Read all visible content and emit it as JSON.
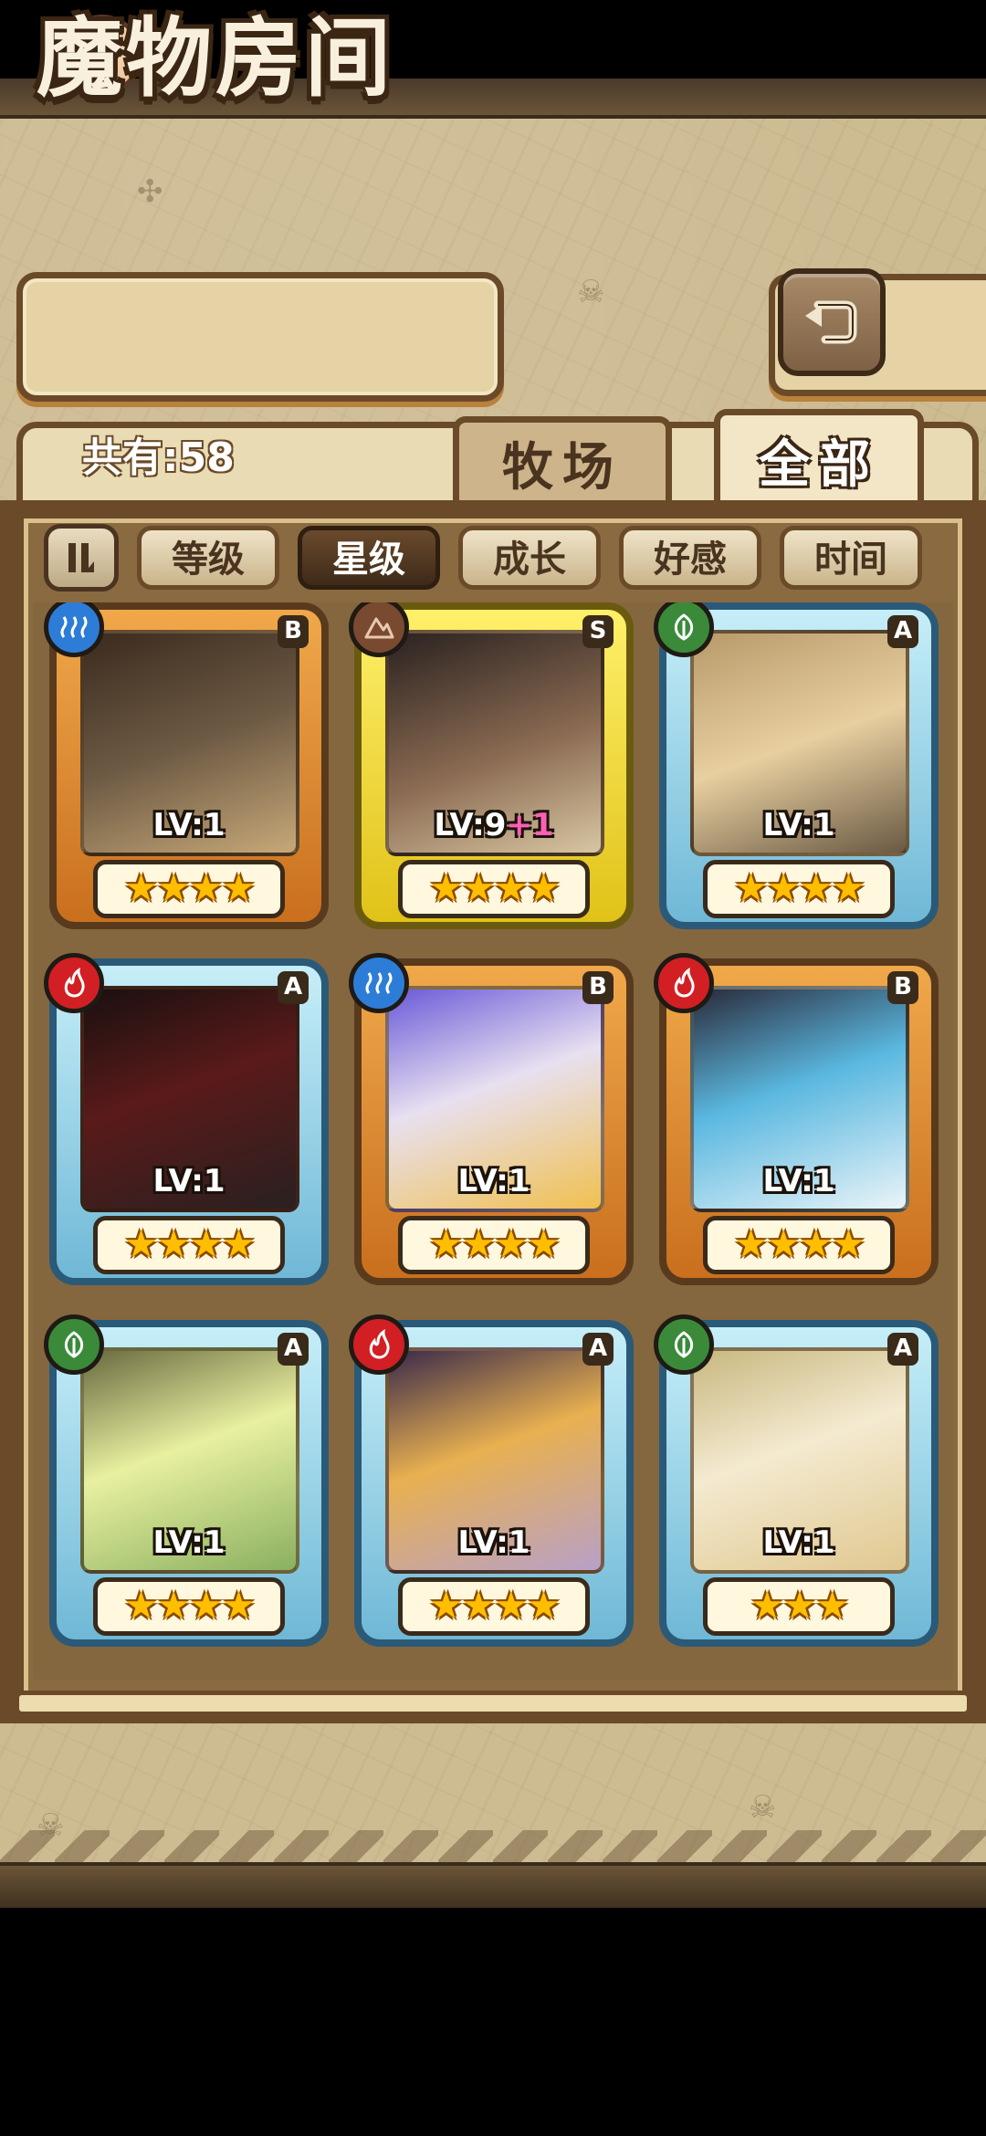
{
  "screen_title": "魔物房间",
  "count_label": "共有:58",
  "tabs": {
    "farm": "牧场",
    "all": "全部"
  },
  "filters": [
    "等级",
    "星级",
    "成长",
    "好感",
    "时间"
  ],
  "active_filter": "星级",
  "cards": [
    {
      "grade": "B",
      "element": "water",
      "level": "LV:1",
      "bonus": "",
      "stars": "★★★★"
    },
    {
      "grade": "S",
      "element": "earth",
      "level": "LV:9",
      "bonus": "+1",
      "stars": "★★★★"
    },
    {
      "grade": "A",
      "element": "grass",
      "level": "LV:1",
      "bonus": "",
      "stars": "★★★★"
    },
    {
      "grade": "A",
      "element": "fire",
      "level": "LV:1",
      "bonus": "",
      "stars": "★★★★"
    },
    {
      "grade": "B",
      "element": "water",
      "level": "LV:1",
      "bonus": "",
      "stars": "★★★★"
    },
    {
      "grade": "B",
      "element": "fire",
      "level": "LV:1",
      "bonus": "",
      "stars": "★★★★"
    },
    {
      "grade": "A",
      "element": "grass",
      "level": "LV:1",
      "bonus": "",
      "stars": "★★★★"
    },
    {
      "grade": "A",
      "element": "fire",
      "level": "LV:1",
      "bonus": "",
      "stars": "★★★★"
    },
    {
      "grade": "A",
      "element": "grass",
      "level": "LV:1",
      "bonus": "",
      "stars": "★★★"
    }
  ],
  "colors": {
    "rank_b": "#e08a2c",
    "rank_s": "#f3dc2e",
    "rank_a": "#8fcbe4",
    "water": "#2d7dd8",
    "fire": "#d21f24",
    "grass": "#3a8a3a",
    "earth": "#7a4a30"
  }
}
